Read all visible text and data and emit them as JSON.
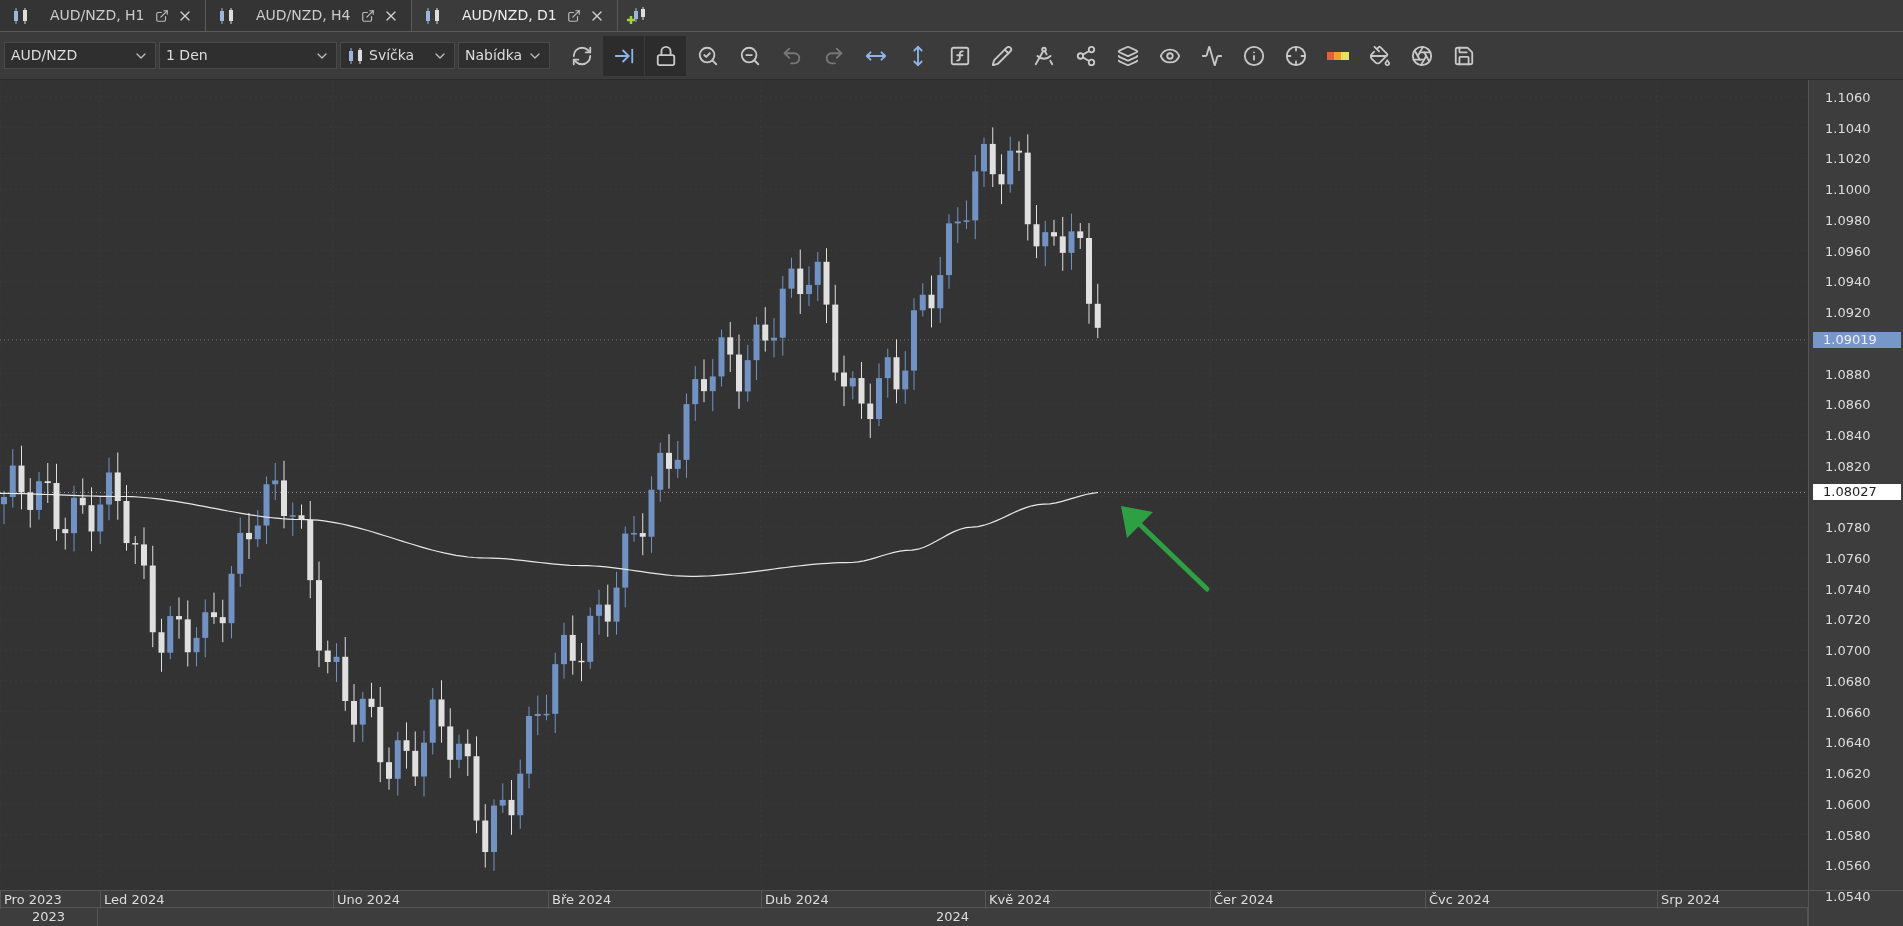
{
  "tabs": [
    {
      "label": "AUD/NZD, H1",
      "selected": false
    },
    {
      "label": "AUD/NZD, H4",
      "selected": false
    },
    {
      "label": "AUD/NZD, D1",
      "selected": true
    }
  ],
  "toolbar": {
    "symbol": "AUD/NZD",
    "timeframe": "1 Den",
    "chart_type": "Svíčka",
    "price_type": "Nabídka",
    "buttons": [
      {
        "selected": false,
        "disabled": false
      },
      {
        "selected": true,
        "disabled": false
      },
      {
        "selected": true,
        "disabled": false
      },
      {
        "selected": false,
        "disabled": false
      },
      {
        "selected": false,
        "disabled": false
      },
      {
        "selected": false,
        "disabled": true
      },
      {
        "selected": false,
        "disabled": true
      },
      {
        "selected": false,
        "disabled": false
      },
      {
        "selected": false,
        "disabled": false
      },
      {
        "selected": false,
        "disabled": false
      },
      {
        "selected": false,
        "disabled": false
      },
      {
        "selected": false,
        "disabled": false
      },
      {
        "selected": false,
        "disabled": false
      },
      {
        "selected": false,
        "disabled": false
      },
      {
        "selected": false,
        "disabled": false
      },
      {
        "selected": false,
        "disabled": false
      },
      {
        "selected": false,
        "disabled": false
      },
      {
        "selected": false,
        "disabled": false
      },
      {
        "selected": false,
        "disabled": false
      },
      {
        "selected": false,
        "disabled": false
      },
      {
        "selected": false,
        "disabled": false
      },
      {
        "selected": false,
        "disabled": false
      }
    ]
  },
  "price_axis": {
    "ticks": [
      "1.1060",
      "1.1040",
      "1.1020",
      "1.1000",
      "1.0980",
      "1.0960",
      "1.0940",
      "1.0920",
      "1.0880",
      "1.0860",
      "1.0840",
      "1.0820",
      "1.0780",
      "1.0760",
      "1.0740",
      "1.0720",
      "1.0700",
      "1.0680",
      "1.0660",
      "1.0640",
      "1.0620",
      "1.0600",
      "1.0580",
      "1.0560",
      "1.0540"
    ],
    "markers": [
      {
        "label": "1.09019",
        "kind": "bid"
      },
      {
        "label": "1.08027",
        "kind": "indicator"
      }
    ]
  },
  "time_axis": {
    "months": [
      "Pro 2023",
      "Led 2024",
      "Uno 2024",
      "Bře 2024",
      "Dub 2024",
      "Kvě 2024",
      "Čer 2024",
      "Čvc 2024",
      "Srp 2024"
    ],
    "years": [
      "2023",
      "2024"
    ]
  }
}
